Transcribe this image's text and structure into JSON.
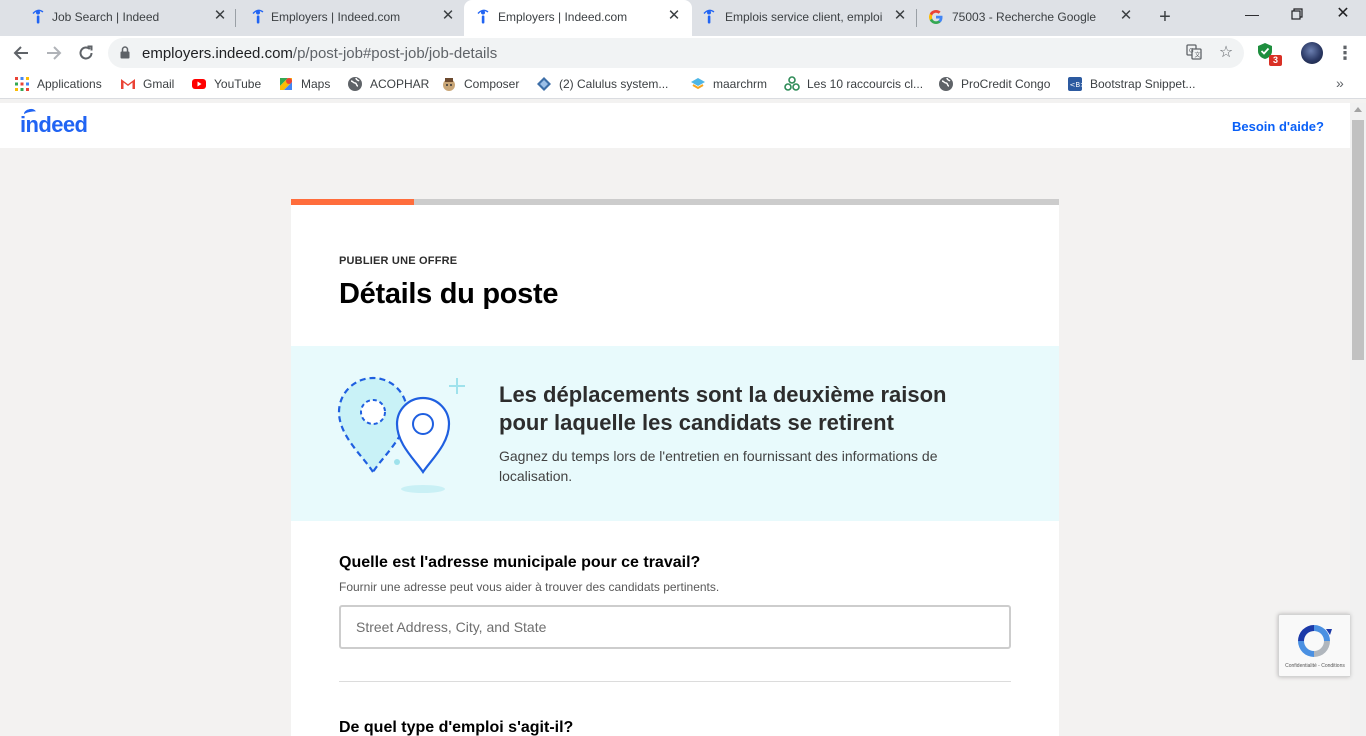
{
  "browser": {
    "tabs": [
      {
        "title": "Job Search | Indeed",
        "icon": "indeed-favicon",
        "active": false
      },
      {
        "title": "Employers | Indeed.com",
        "icon": "indeed-favicon",
        "active": false
      },
      {
        "title": "Employers | Indeed.com",
        "icon": "indeed-favicon",
        "active": true
      },
      {
        "title": "Emplois service client, emploi |",
        "icon": "indeed-favicon",
        "active": false
      },
      {
        "title": "75003 - Recherche Google",
        "icon": "google-favicon",
        "active": false
      }
    ],
    "url_domain": "employers.indeed.com",
    "url_path": "/p/post-job#post-job/job-details",
    "extension_badge": "3",
    "bookmarks": [
      {
        "label": "Applications",
        "icon": "apps-grid-icon"
      },
      {
        "label": "Gmail",
        "icon": "gmail-icon"
      },
      {
        "label": "YouTube",
        "icon": "youtube-icon"
      },
      {
        "label": "Maps",
        "icon": "maps-icon"
      },
      {
        "label": "ACOPHAR",
        "icon": "globe-icon"
      },
      {
        "label": "Composer",
        "icon": "composer-icon"
      },
      {
        "label": "(2) Calulus system...",
        "icon": "calculus-icon"
      },
      {
        "label": "maarchrm",
        "icon": "maarch-icon"
      },
      {
        "label": "Les 10 raccourcis cl...",
        "icon": "shortcuts-icon"
      },
      {
        "label": "ProCredit Congo",
        "icon": "globe-icon"
      },
      {
        "label": "Bootstrap Snippet...",
        "icon": "bootstrap-icon"
      }
    ]
  },
  "header": {
    "logo": "indeed",
    "help_link": "Besoin d'aide?"
  },
  "progress": {
    "fraction": 0.16
  },
  "page": {
    "eyebrow": "PUBLIER UNE OFFRE",
    "title": "Détails du poste",
    "banner": {
      "heading": "Les déplacements sont la deuxième raison pour laquelle les candidats se retirent",
      "subtext": "Gagnez du temps lors de l'entretien en fournissant des informations de localisation."
    },
    "address_question": {
      "label": "Quelle est l'adresse municipale pour ce travail?",
      "hint": "Fournir une adresse peut vous aider à trouver des candidats pertinents.",
      "placeholder": "Street Address, City, and State",
      "value": ""
    },
    "employment_type_question": {
      "label": "De quel type d'emploi s'agit-il?"
    }
  },
  "recaptcha": {
    "footer": "Confidentialité - Conditions"
  },
  "colors": {
    "accent": "#ff6d3c",
    "brand": "#2164f3",
    "banner_bg": "#e8fafc",
    "link": "#085ff7"
  }
}
